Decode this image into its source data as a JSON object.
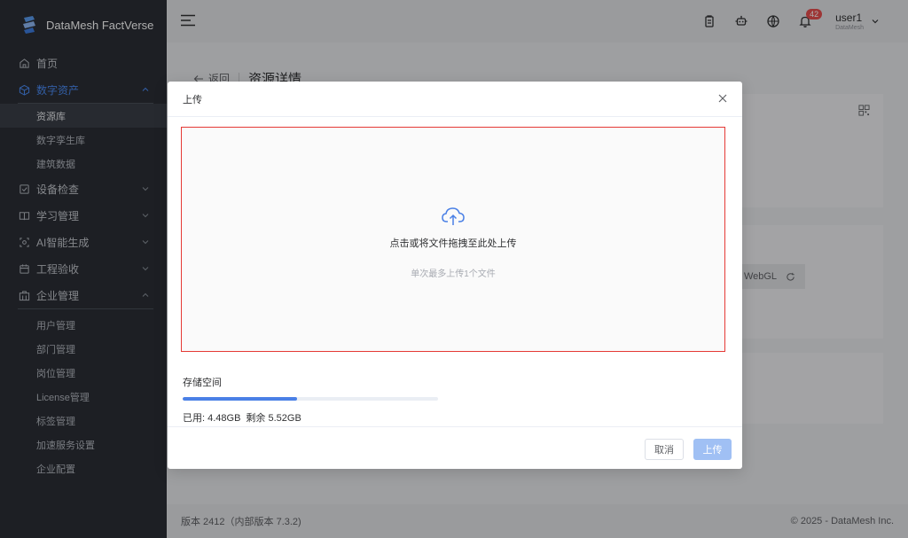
{
  "brand": {
    "name": "DataMesh FactVerse"
  },
  "sidebar": {
    "items": [
      {
        "label": "首页",
        "icon": "home-icon"
      },
      {
        "label": "数字资产",
        "icon": "cube-icon",
        "expanded": true,
        "children": [
          "资源库",
          "数字孪生库",
          "建筑数据"
        ],
        "selected": "资源库"
      },
      {
        "label": "设备检查",
        "icon": "checkbox-icon"
      },
      {
        "label": "学习管理",
        "icon": "book-icon"
      },
      {
        "label": "AI智能生成",
        "icon": "ai-icon"
      },
      {
        "label": "工程验收",
        "icon": "calendar-icon"
      },
      {
        "label": "企业管理",
        "icon": "building-icon",
        "expanded": true,
        "children": [
          "用户管理",
          "部门管理",
          "岗位管理",
          "License管理",
          "标签管理",
          "加速服务设置",
          "企业配置"
        ]
      }
    ]
  },
  "topbar": {
    "notification_count": "42",
    "user_name": "user1",
    "user_org": "DataMesh"
  },
  "page": {
    "back_label": "返回",
    "title": "资源详情",
    "webgl_label": "WebGL"
  },
  "footer": {
    "version": "版本 2412（内部版本 7.3.2)",
    "copyright": "© 2025 - DataMesh Inc."
  },
  "dialog": {
    "title": "上传",
    "upload_text": "点击或将文件拖拽至此处上传",
    "upload_hint": "单次最多上传1个文件",
    "storage_label": "存储空间",
    "used": "已用: 4.48GB",
    "remaining": "剩余 5.52GB",
    "used_fraction": 0.448,
    "cancel_label": "取消",
    "upload_label": "上传"
  },
  "colors": {
    "accent": "#4a80e6",
    "sidebar_bg": "#2b2f36",
    "danger": "#e53935"
  }
}
